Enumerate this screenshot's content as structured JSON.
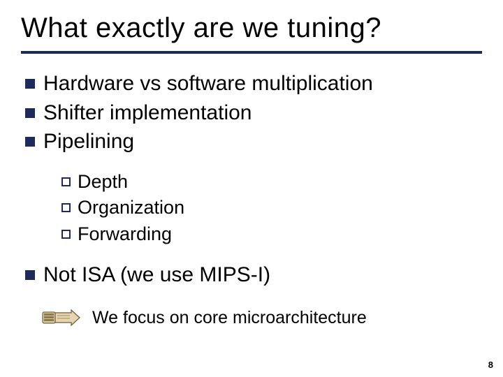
{
  "title": "What exactly are we tuning?",
  "bullets": {
    "b1": "Hardware vs software multiplication",
    "b2": "Shifter implementation",
    "b3": "Pipelining",
    "b3a": "Depth",
    "b3b": "Organization",
    "b3c": "Forwarding",
    "b4": "Not ISA (we use MIPS-I)"
  },
  "callout": "We focus on core microarchitecture",
  "page_number": "8"
}
